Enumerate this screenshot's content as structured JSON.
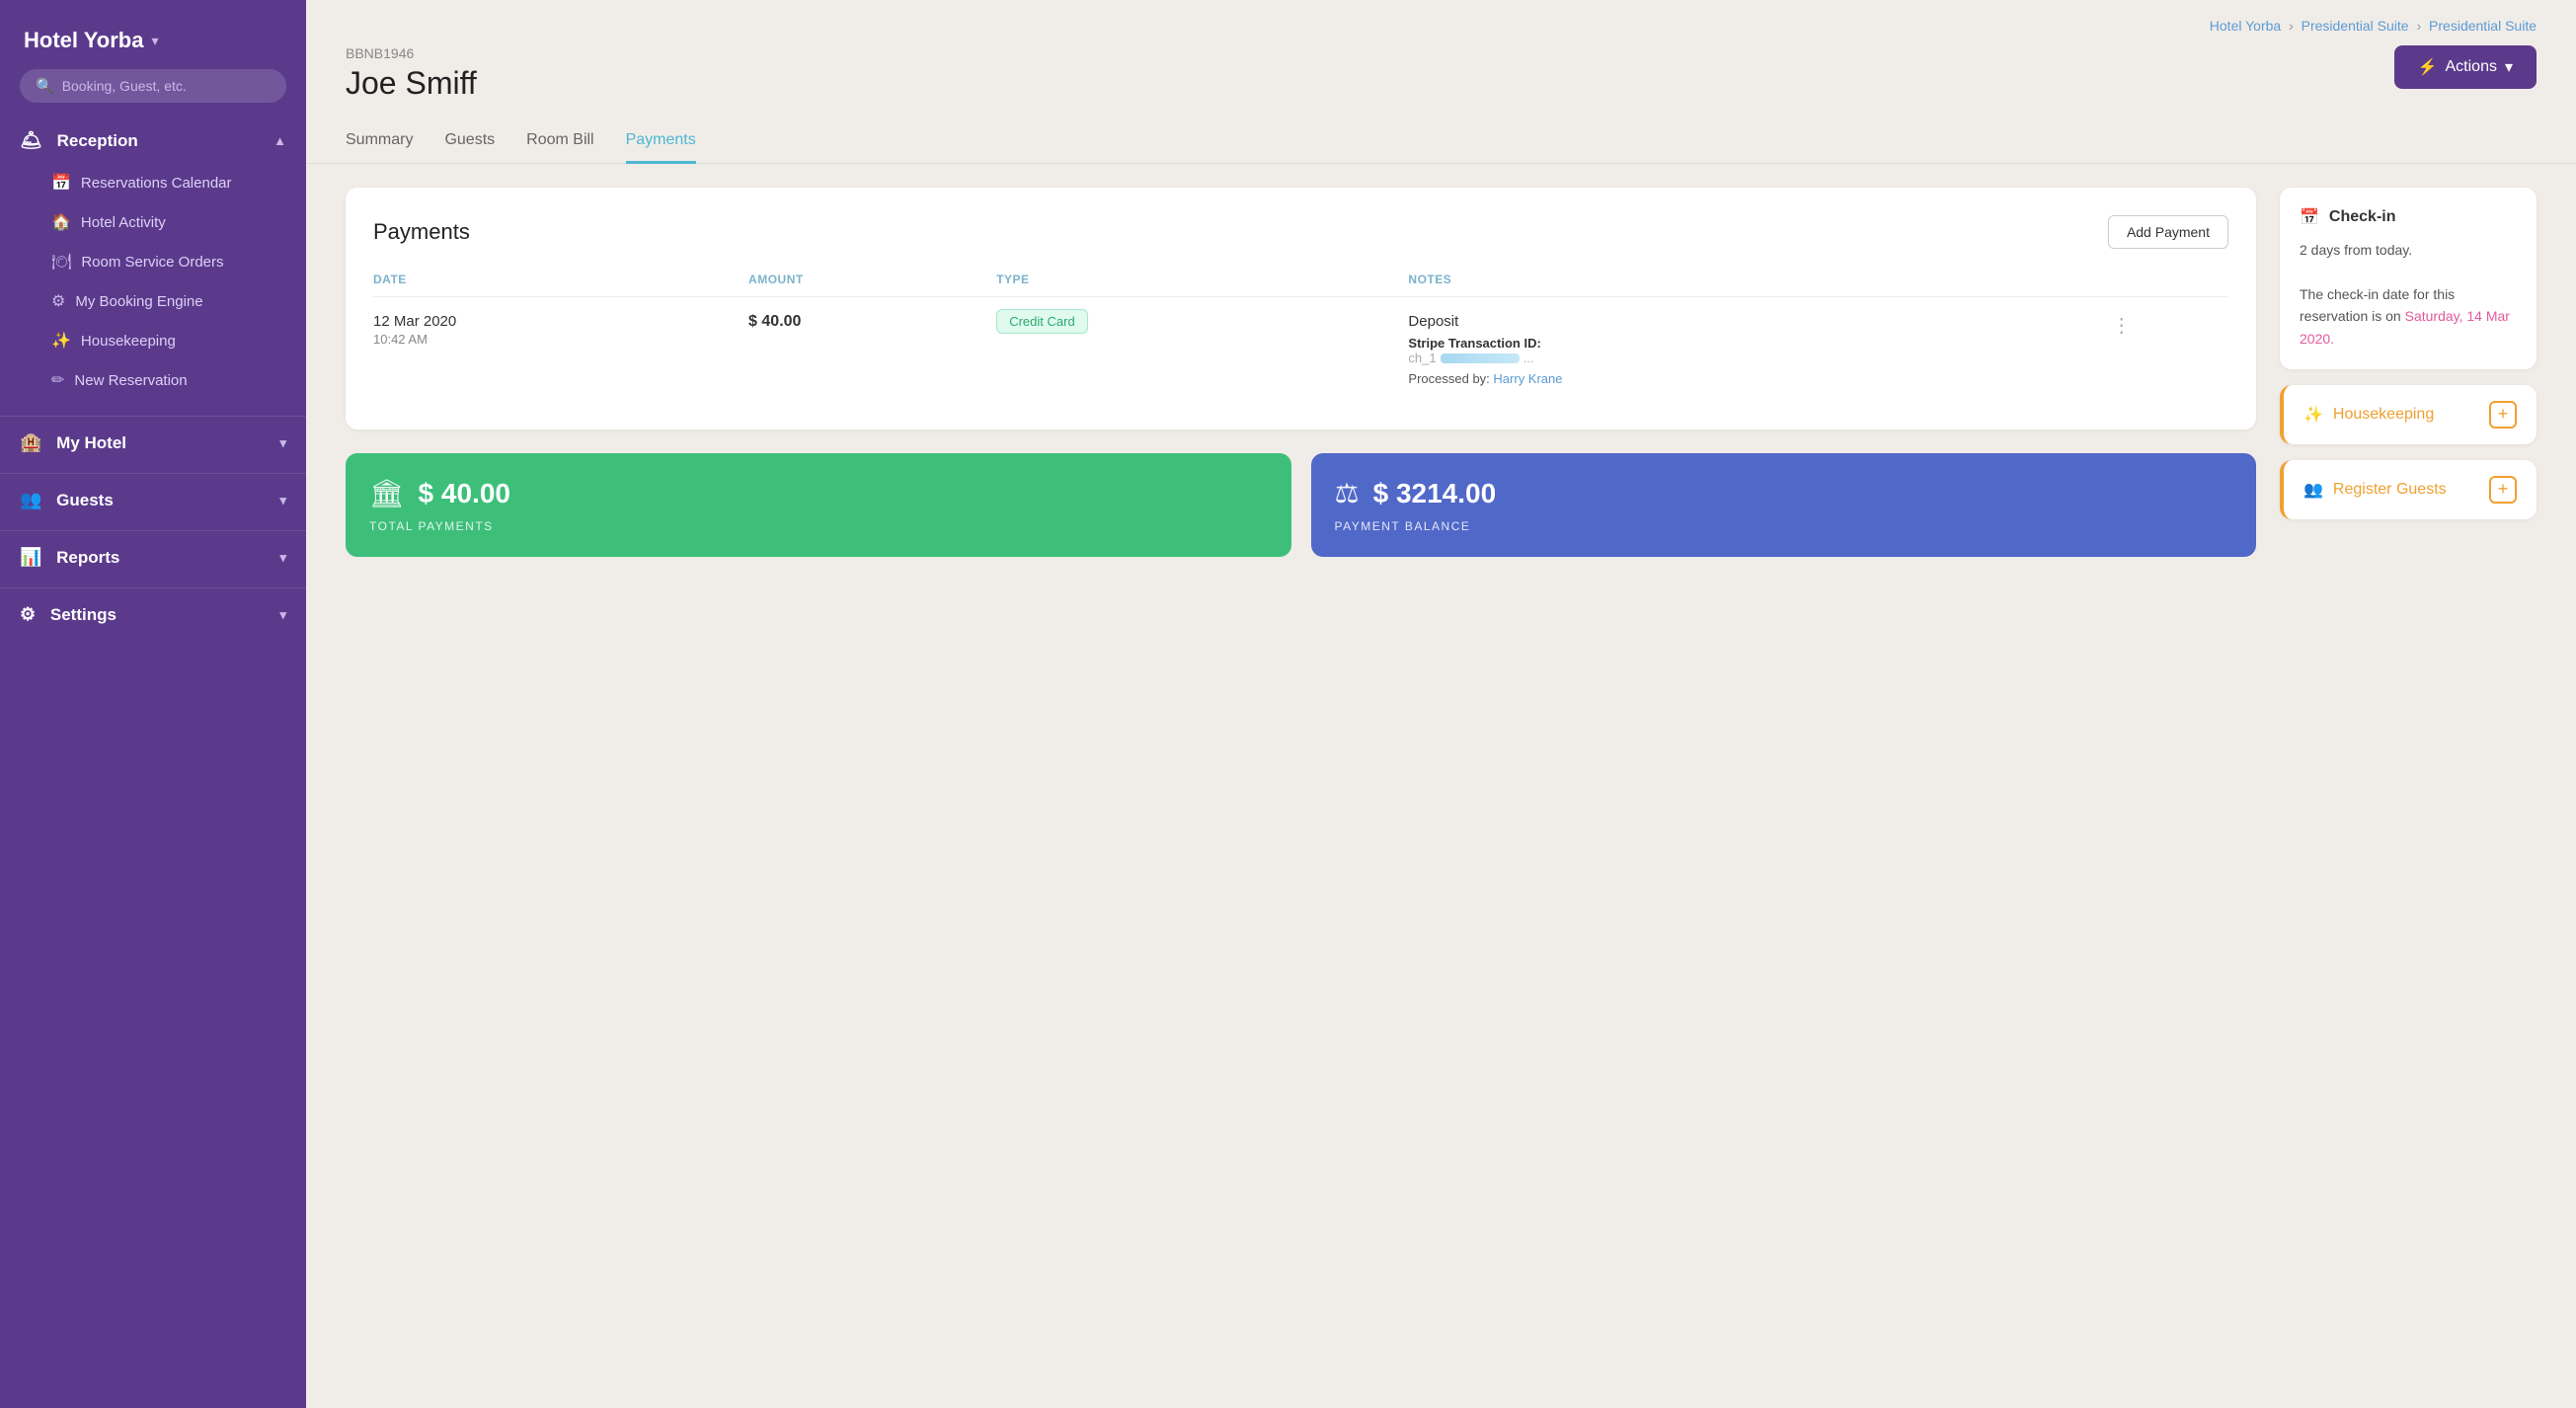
{
  "sidebar": {
    "hotel_name": "Hotel Yorba",
    "search_placeholder": "Booking, Guest, etc.",
    "sections": [
      {
        "id": "reception",
        "label": "Reception",
        "icon": "🛎",
        "expanded": true,
        "items": [
          {
            "id": "reservations-calendar",
            "label": "Reservations Calendar",
            "icon": "📅"
          },
          {
            "id": "hotel-activity",
            "label": "Hotel Activity",
            "icon": "🏠"
          },
          {
            "id": "room-service-orders",
            "label": "Room Service Orders",
            "icon": "🍽"
          },
          {
            "id": "my-booking-engine",
            "label": "My Booking Engine",
            "icon": "⚙"
          },
          {
            "id": "housekeeping",
            "label": "Housekeeping",
            "icon": "✨"
          },
          {
            "id": "new-reservation",
            "label": "New Reservation",
            "icon": "✏"
          }
        ]
      },
      {
        "id": "my-hotel",
        "label": "My Hotel",
        "icon": "🏨",
        "expanded": false,
        "items": []
      },
      {
        "id": "guests",
        "label": "Guests",
        "icon": "👥",
        "expanded": false,
        "items": []
      },
      {
        "id": "reports",
        "label": "Reports",
        "icon": "📊",
        "expanded": false,
        "items": []
      },
      {
        "id": "settings",
        "label": "Settings",
        "icon": "⚙",
        "expanded": false,
        "items": []
      }
    ]
  },
  "breadcrumb": {
    "items": [
      "Hotel Yorba",
      "Presidential Suite",
      "Presidential Suite"
    ]
  },
  "booking": {
    "id": "BBNB1946",
    "guest_name": "Joe Smiff"
  },
  "actions_label": "Actions",
  "tabs": [
    {
      "id": "summary",
      "label": "Summary"
    },
    {
      "id": "guests",
      "label": "Guests"
    },
    {
      "id": "room-bill",
      "label": "Room Bill"
    },
    {
      "id": "payments",
      "label": "Payments"
    }
  ],
  "payments": {
    "title": "Payments",
    "add_payment_label": "Add Payment",
    "columns": {
      "date": "DATE",
      "amount": "AMOUNT",
      "type": "TYPE",
      "notes": "NOTES"
    },
    "rows": [
      {
        "date": "12 Mar 2020",
        "time": "10:42 AM",
        "amount": "$ 40.00",
        "type": "Credit Card",
        "note_title": "Deposit",
        "stripe_label": "Stripe Transaction ID:",
        "stripe_id": "ch_1GLSFGKS58lPvpx...",
        "processed_label": "Processed by:",
        "processed_by": "Harry Krane"
      }
    ]
  },
  "summary_cards": [
    {
      "id": "total-payments",
      "icon": "🏛",
      "amount": "$ 40.00",
      "label": "TOTAL PAYMENTS",
      "color": "green"
    },
    {
      "id": "payment-balance",
      "icon": "⚖",
      "amount": "$ 3214.00",
      "label": "PAYMENT BALANCE",
      "color": "blue"
    }
  ],
  "side_panel": {
    "checkin": {
      "title": "Check-in",
      "subtitle": "2 days from today.",
      "body": "The check-in date for this reservation is on",
      "date_link": "Saturday, 14 Mar 2020."
    },
    "actions": [
      {
        "id": "housekeeping",
        "label": "Housekeeping",
        "icon": "✨"
      },
      {
        "id": "register-guests",
        "label": "Register Guests",
        "icon": "👥"
      }
    ]
  }
}
